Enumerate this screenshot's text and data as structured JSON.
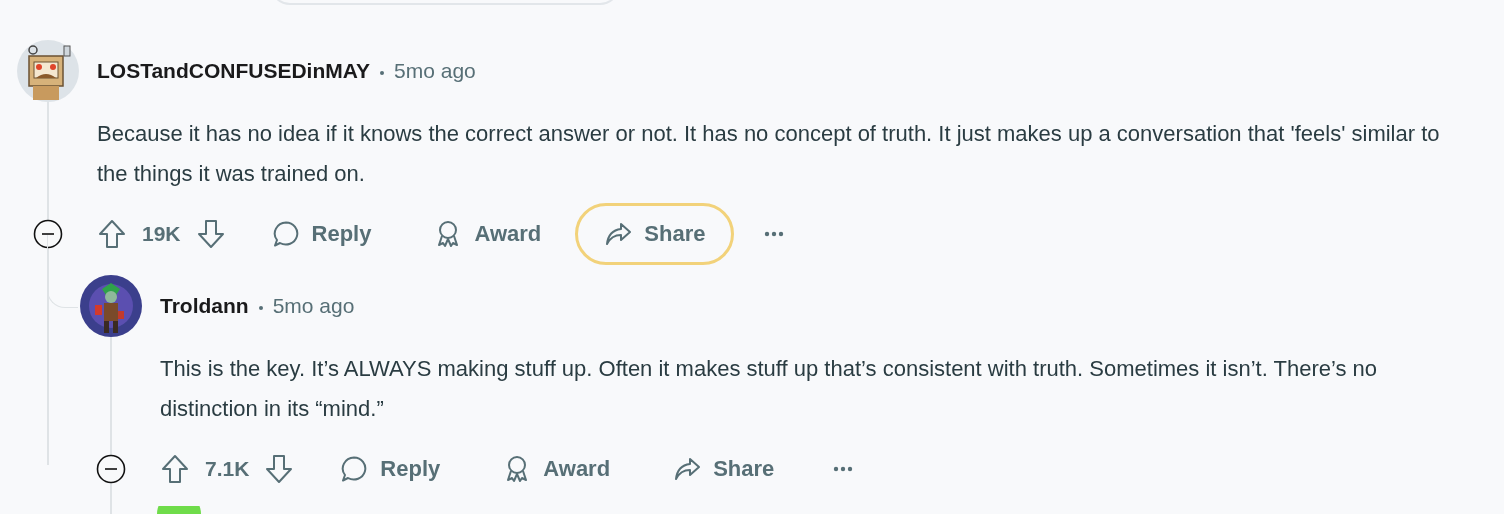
{
  "comments": [
    {
      "author": "LOSTandCONFUSEDinMAY",
      "time": "5mo ago",
      "avatar": {
        "kind": "robot"
      },
      "body": "Because it has no idea if it knows the correct answer or not. It has no concept of truth. It just makes up a conversation that 'feels' similar to the things it was trained on.",
      "votes": "19K",
      "actions": [
        {
          "kind": "reply",
          "label": "Reply",
          "focused": false
        },
        {
          "kind": "award",
          "label": "Award",
          "focused": false
        },
        {
          "kind": "share",
          "label": "Share",
          "focused": true
        }
      ],
      "replies": [
        {
          "author": "Troldann",
          "time": "5mo ago",
          "avatar": {
            "kind": "figure"
          },
          "body": "This is the key. It’s ALWAYS making stuff up. Often it makes stuff up that’s consistent with truth. Sometimes it isn’t. There’s no distinction in its “mind.”",
          "votes": "7.1K",
          "actions": [
            {
              "kind": "reply",
              "label": "Reply",
              "focused": false
            },
            {
              "kind": "award",
              "label": "Award",
              "focused": false
            },
            {
              "kind": "share",
              "label": "Share",
              "focused": false
            }
          ]
        }
      ]
    }
  ]
}
